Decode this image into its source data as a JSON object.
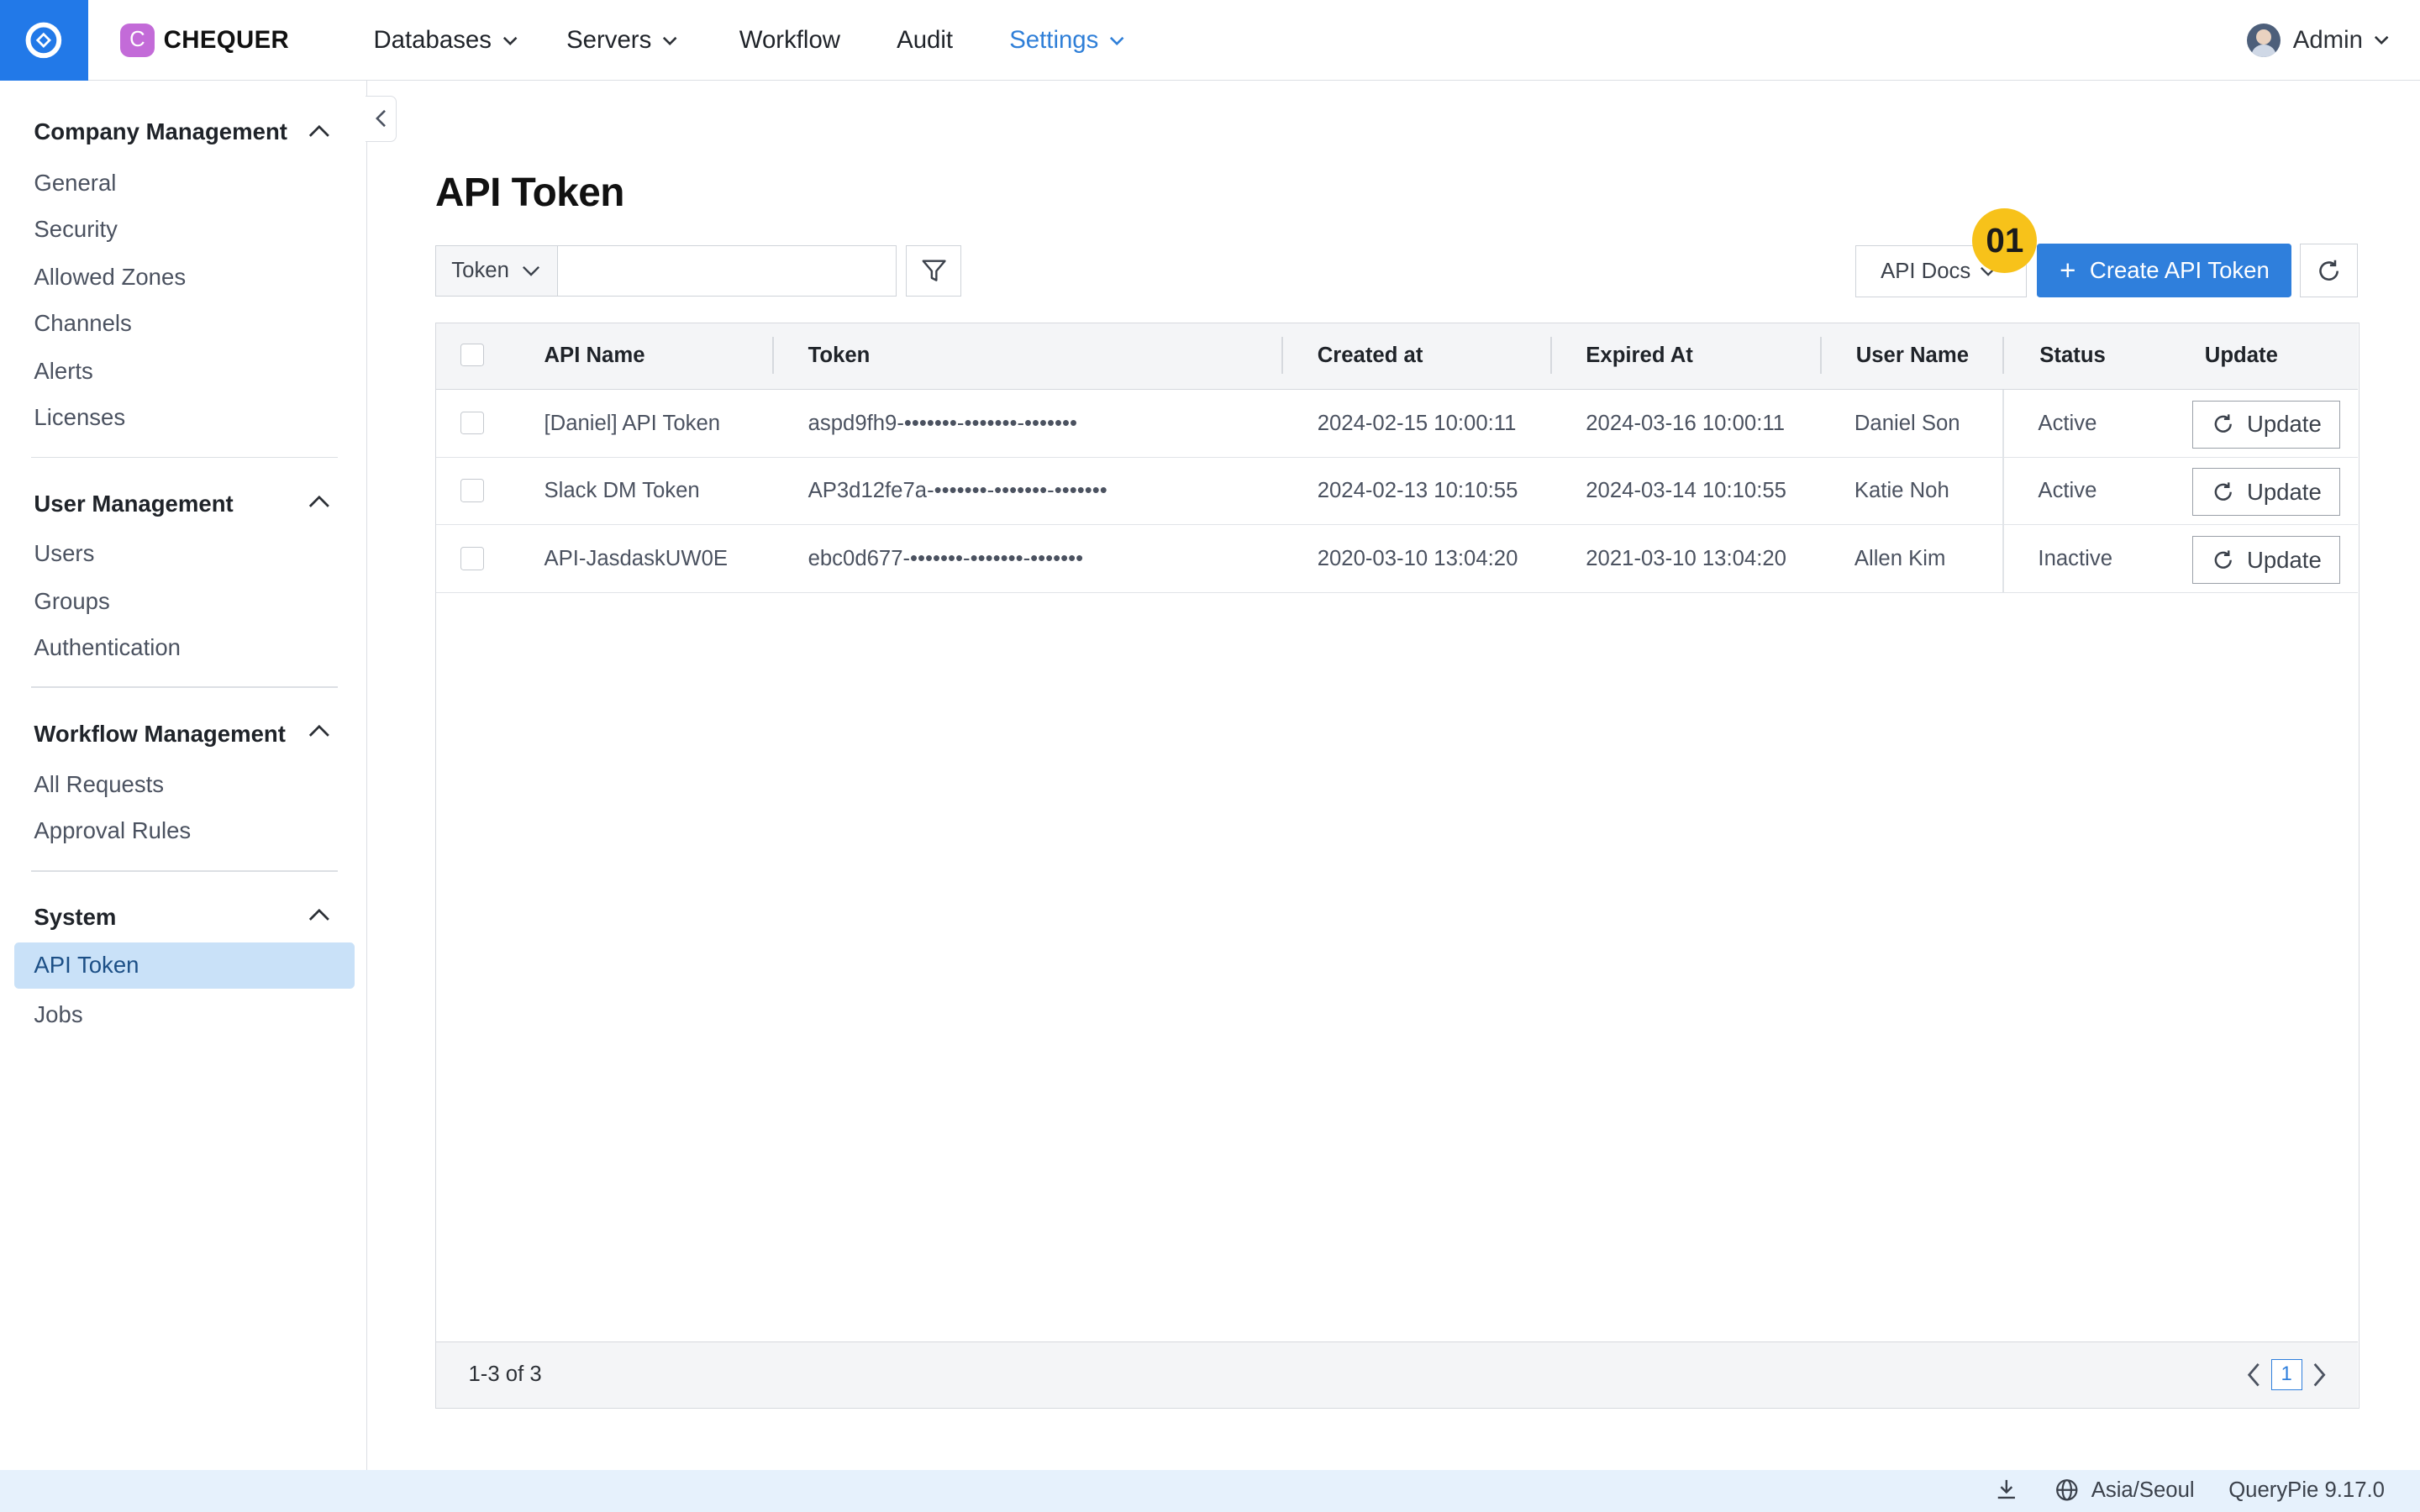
{
  "header": {
    "brand_letter": "C",
    "brand": "CHEQUER",
    "nav": [
      {
        "label": "Databases"
      },
      {
        "label": "Servers"
      },
      {
        "label": "Workflow"
      },
      {
        "label": "Audit"
      },
      {
        "label": "Settings"
      }
    ],
    "user": "Admin"
  },
  "sidebar": {
    "sections": [
      {
        "title": "Company Management",
        "items": [
          "General",
          "Security",
          "Allowed Zones",
          "Channels",
          "Alerts",
          "Licenses"
        ]
      },
      {
        "title": "User Management",
        "items": [
          "Users",
          "Groups",
          "Authentication"
        ]
      },
      {
        "title": "Workflow Management",
        "items": [
          "All Requests",
          "Approval Rules"
        ]
      },
      {
        "title": "System",
        "items": [
          "API Token",
          "Jobs"
        ]
      }
    ],
    "active_item": "API Token"
  },
  "main": {
    "title": "API Token",
    "search_type": "Token",
    "search_value": "",
    "api_docs": "API Docs",
    "badge": "01",
    "create_label": "Create API Token"
  },
  "table": {
    "headers": [
      "API Name",
      "Token",
      "Created at",
      "Expired At",
      "User Name",
      "Status",
      "Update"
    ],
    "rows": [
      {
        "name": "[Daniel] API Token",
        "token": "aspd9fh9-•••••••-•••••••-•••••••",
        "created": "2024-02-15 10:00:11",
        "expired": "2024-03-16 10:00:11",
        "user": "Daniel Son",
        "status": "Active",
        "update": "Update"
      },
      {
        "name": "Slack DM Token",
        "token": "AP3d12fe7a-•••••••-•••••••-•••••••",
        "created": "2024-02-13 10:10:55",
        "expired": "2024-03-14 10:10:55",
        "user": "Katie Noh",
        "status": "Active",
        "update": "Update"
      },
      {
        "name": "API-JasdaskUW0E",
        "token": "ebc0d677-•••••••-•••••••-•••••••",
        "created": "2020-03-10 13:04:20",
        "expired": "2021-03-10 13:04:20",
        "user": "Allen Kim",
        "status": "Inactive",
        "update": "Update"
      }
    ],
    "count": "1-3 of 3",
    "current_page": "1"
  },
  "statusbar": {
    "timezone": "Asia/Seoul",
    "version": "QueryPie 9.17.0"
  },
  "colors": {
    "accent": "#2f7fdc",
    "logo_bg": "#2279e8",
    "badge": "#f7c21a",
    "active_bg": "#c9e1f8",
    "statusbar_bg": "#e6f1fc"
  }
}
